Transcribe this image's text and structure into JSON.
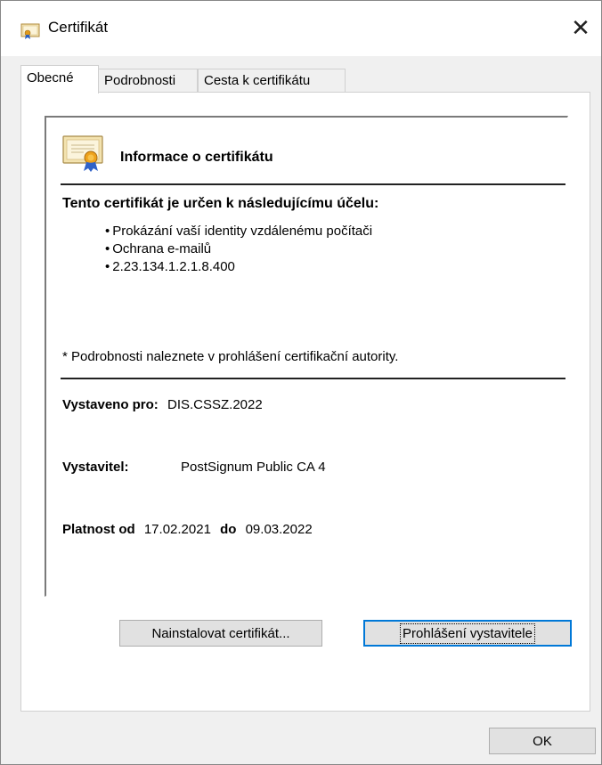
{
  "window": {
    "title": "Certifikát",
    "close_symbol": "✕"
  },
  "tabs": [
    {
      "label": "Obecné",
      "active": true
    },
    {
      "label": "Podrobnosti",
      "active": false
    },
    {
      "label": "Cesta k certifikátu",
      "active": false
    }
  ],
  "certificate": {
    "header": "Informace o certifikátu",
    "purpose_heading": "Tento certifikát je určen k následujícímu účelu:",
    "purposes": [
      "Prokázání vaší identity vzdálenému počítači",
      "Ochrana e-mailů",
      "2.23.134.1.2.1.8.400"
    ],
    "note": "* Podrobnosti naleznete v prohlášení certifikační autority.",
    "issued_to_label": "Vystaveno pro:",
    "issued_to": "DIS.CSSZ.2022",
    "issuer_label": "Vystavitel:",
    "issuer": "PostSignum Public CA 4",
    "valid_from_label": "Platnost od",
    "valid_from": "17.02.2021",
    "valid_to_label": "do",
    "valid_to": "09.03.2022"
  },
  "buttons": {
    "install": "Nainstalovat certifikát...",
    "issuer_statement": "Prohlášení vystavitele",
    "ok": "OK"
  },
  "icons": {
    "title": "certificate-icon",
    "cert_large": "certificate-ribbon-icon",
    "close": "close-icon"
  },
  "colors": {
    "focus_border": "#0078d7",
    "button_bg": "#e1e1e1",
    "window_bg": "#f0f0f0"
  }
}
